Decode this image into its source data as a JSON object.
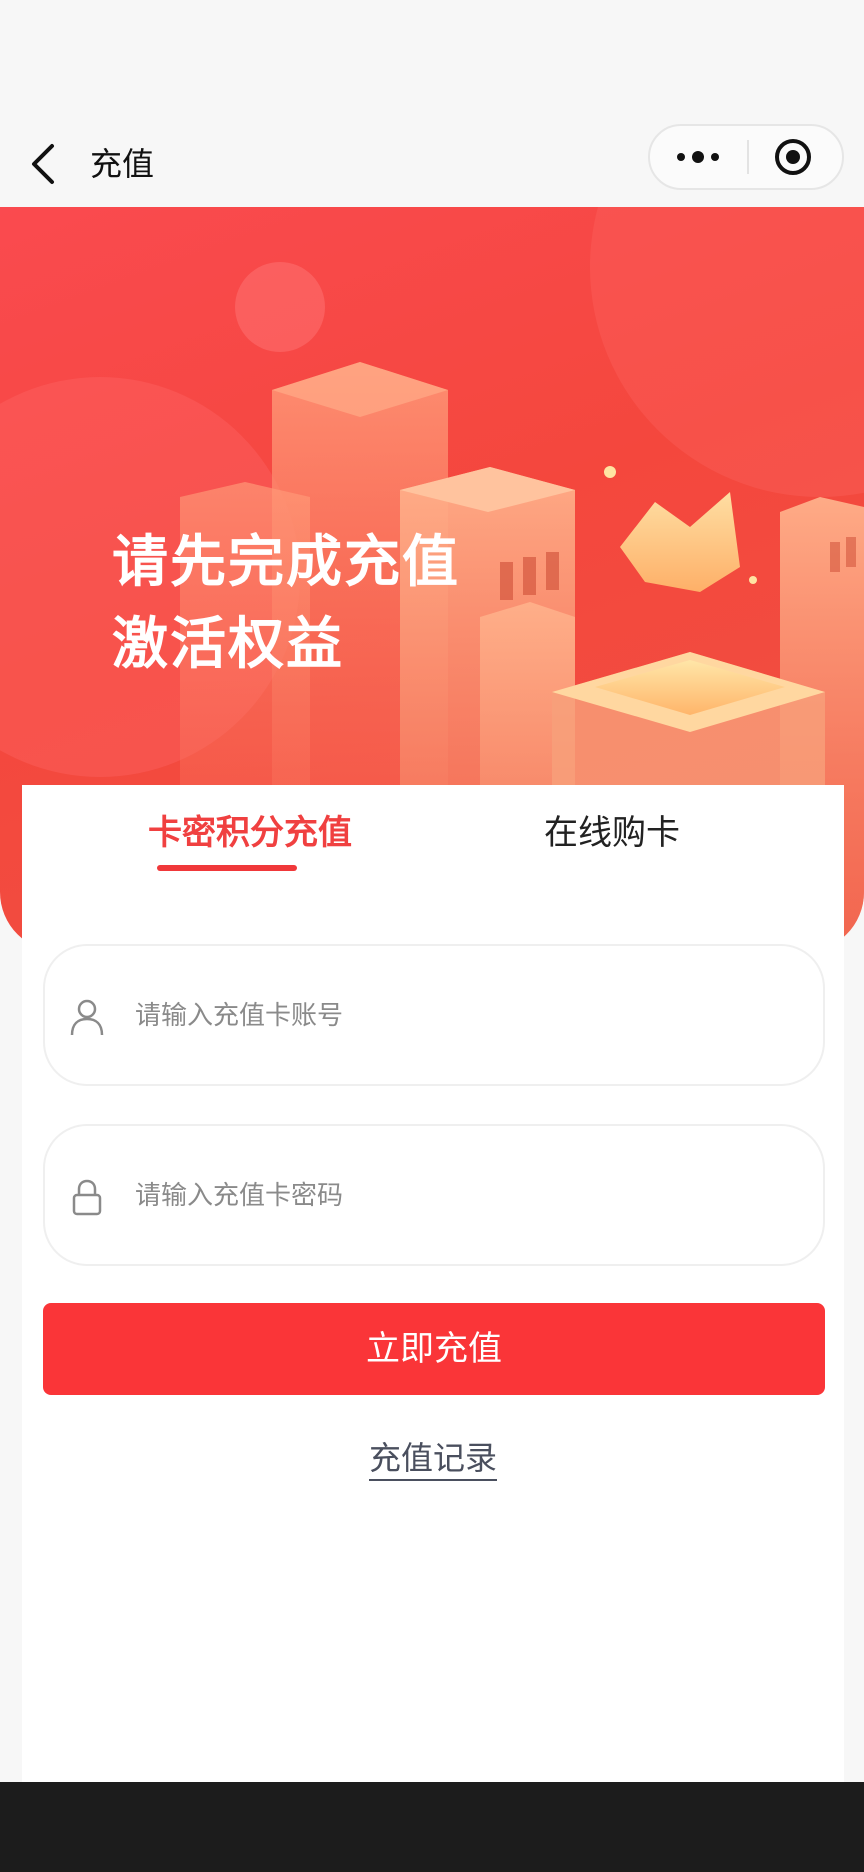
{
  "nav": {
    "title": "充值"
  },
  "hero": {
    "line1": "请先完成充值",
    "line2": "激活权益"
  },
  "tabs": [
    {
      "label": "卡密积分充值",
      "active": true
    },
    {
      "label": "在线购卡",
      "active": false
    }
  ],
  "form": {
    "account_placeholder": "请输入充值卡账号",
    "password_placeholder": "请输入充值卡密码",
    "submit_label": "立即充值",
    "records_label": "充值记录"
  },
  "icons": {
    "back": "chevron-left-icon",
    "more": "more-dots-icon",
    "close": "target-icon",
    "user": "user-icon",
    "lock": "lock-icon"
  },
  "colors": {
    "accent": "#f0383a",
    "button": "#fa3538",
    "hero": "#f4473d",
    "link": "#4a4f5e"
  }
}
